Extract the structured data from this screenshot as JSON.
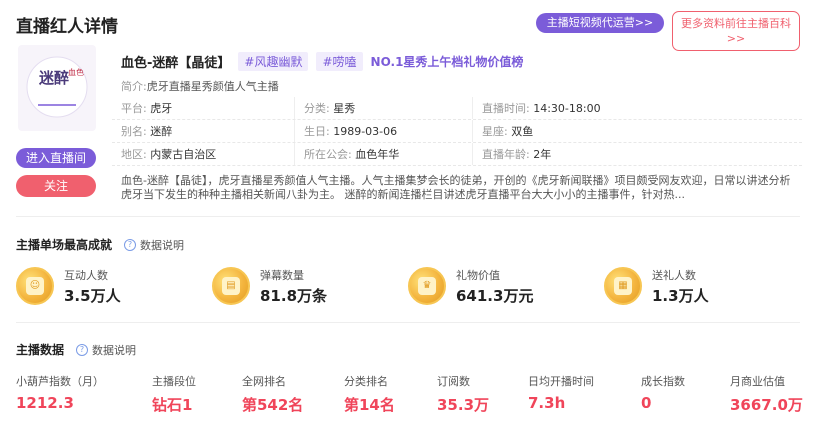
{
  "header": {
    "title": "直播红人详情",
    "short_video_btn": "主播短视频代运营>>",
    "baike_btn_line1": "更多资料前往主播百科",
    "baike_btn_line2": ">>"
  },
  "profile": {
    "name": "血色-迷醉【晶徒】",
    "tags": [
      "#风趣幽默",
      "#唠嗑"
    ],
    "rank_text": "NO.1星秀上午档礼物价值榜",
    "intro_label": "简介:",
    "intro": "虎牙直播星秀颜值人气主播",
    "avatar_text": "迷醉",
    "avatar_small": "血色",
    "enter_btn": "进入直播间",
    "follow_btn": "关注"
  },
  "info": [
    [
      {
        "label": "平台:",
        "value": "虎牙"
      },
      {
        "label": "分类:",
        "value": "星秀"
      },
      {
        "label": "直播时间:",
        "value": "14:30-18:00"
      }
    ],
    [
      {
        "label": "别名:",
        "value": "迷醉"
      },
      {
        "label": "生日:",
        "value": "1989-03-06"
      },
      {
        "label": "星座:",
        "value": "双鱼"
      }
    ],
    [
      {
        "label": "地区:",
        "value": "内蒙古自治区"
      },
      {
        "label": "所在公会:",
        "value": "血色年华"
      },
      {
        "label": "直播年龄:",
        "value": "2年"
      }
    ]
  ],
  "description": "血色-迷醉【晶徒】，虎牙直播星秀颜值人气主播。人气主播集梦会长的徒弟，开创的《虎牙新闻联播》项目颇受网友欢迎，日常以讲述分析虎牙当下发生的种种主播相关新闻八卦为主。 迷醉的新闻连播栏目讲述虎牙直播平台大大小小的主播事件，针对热...",
  "achievements": {
    "title": "主播单场最高成就",
    "help": "数据说明",
    "items": [
      {
        "label": "互动人数",
        "value": "3.5万人",
        "icon": "interaction-icon"
      },
      {
        "label": "弹幕数量",
        "value": "81.8万条",
        "icon": "danmaku-icon"
      },
      {
        "label": "礼物价值",
        "value": "641.3万元",
        "icon": "gift-crown-icon"
      },
      {
        "label": "送礼人数",
        "value": "1.3万人",
        "icon": "gift-sender-icon"
      }
    ]
  },
  "stats": {
    "title": "主播数据",
    "help": "数据说明",
    "items": [
      {
        "label": "小葫芦指数（月）",
        "value": "1212.3"
      },
      {
        "label": "主播段位",
        "value": "钻石1"
      },
      {
        "label": "全网排名",
        "value": "第542名"
      },
      {
        "label": "分类排名",
        "value": "第14名"
      },
      {
        "label": "订阅数",
        "value": "35.3万"
      },
      {
        "label": "日均开播时间",
        "value": "7.3h"
      },
      {
        "label": "成长指数",
        "value": "0"
      },
      {
        "label": "月商业估值",
        "value": "3667.0万"
      }
    ]
  },
  "colors": {
    "accent": "#7b5cd9",
    "danger": "#f0606e",
    "value_red": "#f0455a"
  }
}
